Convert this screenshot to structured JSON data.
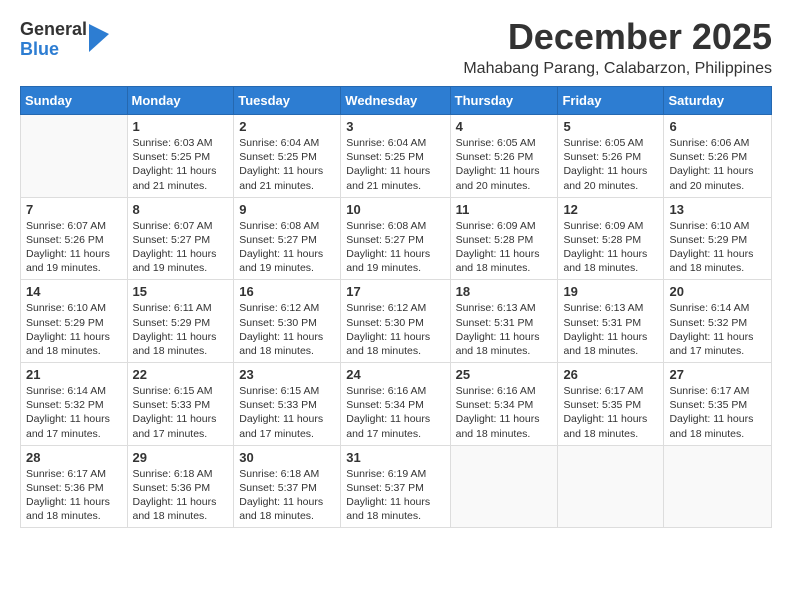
{
  "header": {
    "logo_general": "General",
    "logo_blue": "Blue",
    "month_title": "December 2025",
    "location": "Mahabang Parang, Calabarzon, Philippines"
  },
  "weekdays": [
    "Sunday",
    "Monday",
    "Tuesday",
    "Wednesday",
    "Thursday",
    "Friday",
    "Saturday"
  ],
  "weeks": [
    [
      {
        "day": "",
        "sunrise": "",
        "sunset": "",
        "daylight": ""
      },
      {
        "day": "1",
        "sunrise": "Sunrise: 6:03 AM",
        "sunset": "Sunset: 5:25 PM",
        "daylight": "Daylight: 11 hours and 21 minutes."
      },
      {
        "day": "2",
        "sunrise": "Sunrise: 6:04 AM",
        "sunset": "Sunset: 5:25 PM",
        "daylight": "Daylight: 11 hours and 21 minutes."
      },
      {
        "day": "3",
        "sunrise": "Sunrise: 6:04 AM",
        "sunset": "Sunset: 5:25 PM",
        "daylight": "Daylight: 11 hours and 21 minutes."
      },
      {
        "day": "4",
        "sunrise": "Sunrise: 6:05 AM",
        "sunset": "Sunset: 5:26 PM",
        "daylight": "Daylight: 11 hours and 20 minutes."
      },
      {
        "day": "5",
        "sunrise": "Sunrise: 6:05 AM",
        "sunset": "Sunset: 5:26 PM",
        "daylight": "Daylight: 11 hours and 20 minutes."
      },
      {
        "day": "6",
        "sunrise": "Sunrise: 6:06 AM",
        "sunset": "Sunset: 5:26 PM",
        "daylight": "Daylight: 11 hours and 20 minutes."
      }
    ],
    [
      {
        "day": "7",
        "sunrise": "Sunrise: 6:07 AM",
        "sunset": "Sunset: 5:26 PM",
        "daylight": "Daylight: 11 hours and 19 minutes."
      },
      {
        "day": "8",
        "sunrise": "Sunrise: 6:07 AM",
        "sunset": "Sunset: 5:27 PM",
        "daylight": "Daylight: 11 hours and 19 minutes."
      },
      {
        "day": "9",
        "sunrise": "Sunrise: 6:08 AM",
        "sunset": "Sunset: 5:27 PM",
        "daylight": "Daylight: 11 hours and 19 minutes."
      },
      {
        "day": "10",
        "sunrise": "Sunrise: 6:08 AM",
        "sunset": "Sunset: 5:27 PM",
        "daylight": "Daylight: 11 hours and 19 minutes."
      },
      {
        "day": "11",
        "sunrise": "Sunrise: 6:09 AM",
        "sunset": "Sunset: 5:28 PM",
        "daylight": "Daylight: 11 hours and 18 minutes."
      },
      {
        "day": "12",
        "sunrise": "Sunrise: 6:09 AM",
        "sunset": "Sunset: 5:28 PM",
        "daylight": "Daylight: 11 hours and 18 minutes."
      },
      {
        "day": "13",
        "sunrise": "Sunrise: 6:10 AM",
        "sunset": "Sunset: 5:29 PM",
        "daylight": "Daylight: 11 hours and 18 minutes."
      }
    ],
    [
      {
        "day": "14",
        "sunrise": "Sunrise: 6:10 AM",
        "sunset": "Sunset: 5:29 PM",
        "daylight": "Daylight: 11 hours and 18 minutes."
      },
      {
        "day": "15",
        "sunrise": "Sunrise: 6:11 AM",
        "sunset": "Sunset: 5:29 PM",
        "daylight": "Daylight: 11 hours and 18 minutes."
      },
      {
        "day": "16",
        "sunrise": "Sunrise: 6:12 AM",
        "sunset": "Sunset: 5:30 PM",
        "daylight": "Daylight: 11 hours and 18 minutes."
      },
      {
        "day": "17",
        "sunrise": "Sunrise: 6:12 AM",
        "sunset": "Sunset: 5:30 PM",
        "daylight": "Daylight: 11 hours and 18 minutes."
      },
      {
        "day": "18",
        "sunrise": "Sunrise: 6:13 AM",
        "sunset": "Sunset: 5:31 PM",
        "daylight": "Daylight: 11 hours and 18 minutes."
      },
      {
        "day": "19",
        "sunrise": "Sunrise: 6:13 AM",
        "sunset": "Sunset: 5:31 PM",
        "daylight": "Daylight: 11 hours and 18 minutes."
      },
      {
        "day": "20",
        "sunrise": "Sunrise: 6:14 AM",
        "sunset": "Sunset: 5:32 PM",
        "daylight": "Daylight: 11 hours and 17 minutes."
      }
    ],
    [
      {
        "day": "21",
        "sunrise": "Sunrise: 6:14 AM",
        "sunset": "Sunset: 5:32 PM",
        "daylight": "Daylight: 11 hours and 17 minutes."
      },
      {
        "day": "22",
        "sunrise": "Sunrise: 6:15 AM",
        "sunset": "Sunset: 5:33 PM",
        "daylight": "Daylight: 11 hours and 17 minutes."
      },
      {
        "day": "23",
        "sunrise": "Sunrise: 6:15 AM",
        "sunset": "Sunset: 5:33 PM",
        "daylight": "Daylight: 11 hours and 17 minutes."
      },
      {
        "day": "24",
        "sunrise": "Sunrise: 6:16 AM",
        "sunset": "Sunset: 5:34 PM",
        "daylight": "Daylight: 11 hours and 17 minutes."
      },
      {
        "day": "25",
        "sunrise": "Sunrise: 6:16 AM",
        "sunset": "Sunset: 5:34 PM",
        "daylight": "Daylight: 11 hours and 18 minutes."
      },
      {
        "day": "26",
        "sunrise": "Sunrise: 6:17 AM",
        "sunset": "Sunset: 5:35 PM",
        "daylight": "Daylight: 11 hours and 18 minutes."
      },
      {
        "day": "27",
        "sunrise": "Sunrise: 6:17 AM",
        "sunset": "Sunset: 5:35 PM",
        "daylight": "Daylight: 11 hours and 18 minutes."
      }
    ],
    [
      {
        "day": "28",
        "sunrise": "Sunrise: 6:17 AM",
        "sunset": "Sunset: 5:36 PM",
        "daylight": "Daylight: 11 hours and 18 minutes."
      },
      {
        "day": "29",
        "sunrise": "Sunrise: 6:18 AM",
        "sunset": "Sunset: 5:36 PM",
        "daylight": "Daylight: 11 hours and 18 minutes."
      },
      {
        "day": "30",
        "sunrise": "Sunrise: 6:18 AM",
        "sunset": "Sunset: 5:37 PM",
        "daylight": "Daylight: 11 hours and 18 minutes."
      },
      {
        "day": "31",
        "sunrise": "Sunrise: 6:19 AM",
        "sunset": "Sunset: 5:37 PM",
        "daylight": "Daylight: 11 hours and 18 minutes."
      },
      {
        "day": "",
        "sunrise": "",
        "sunset": "",
        "daylight": ""
      },
      {
        "day": "",
        "sunrise": "",
        "sunset": "",
        "daylight": ""
      },
      {
        "day": "",
        "sunrise": "",
        "sunset": "",
        "daylight": ""
      }
    ]
  ]
}
